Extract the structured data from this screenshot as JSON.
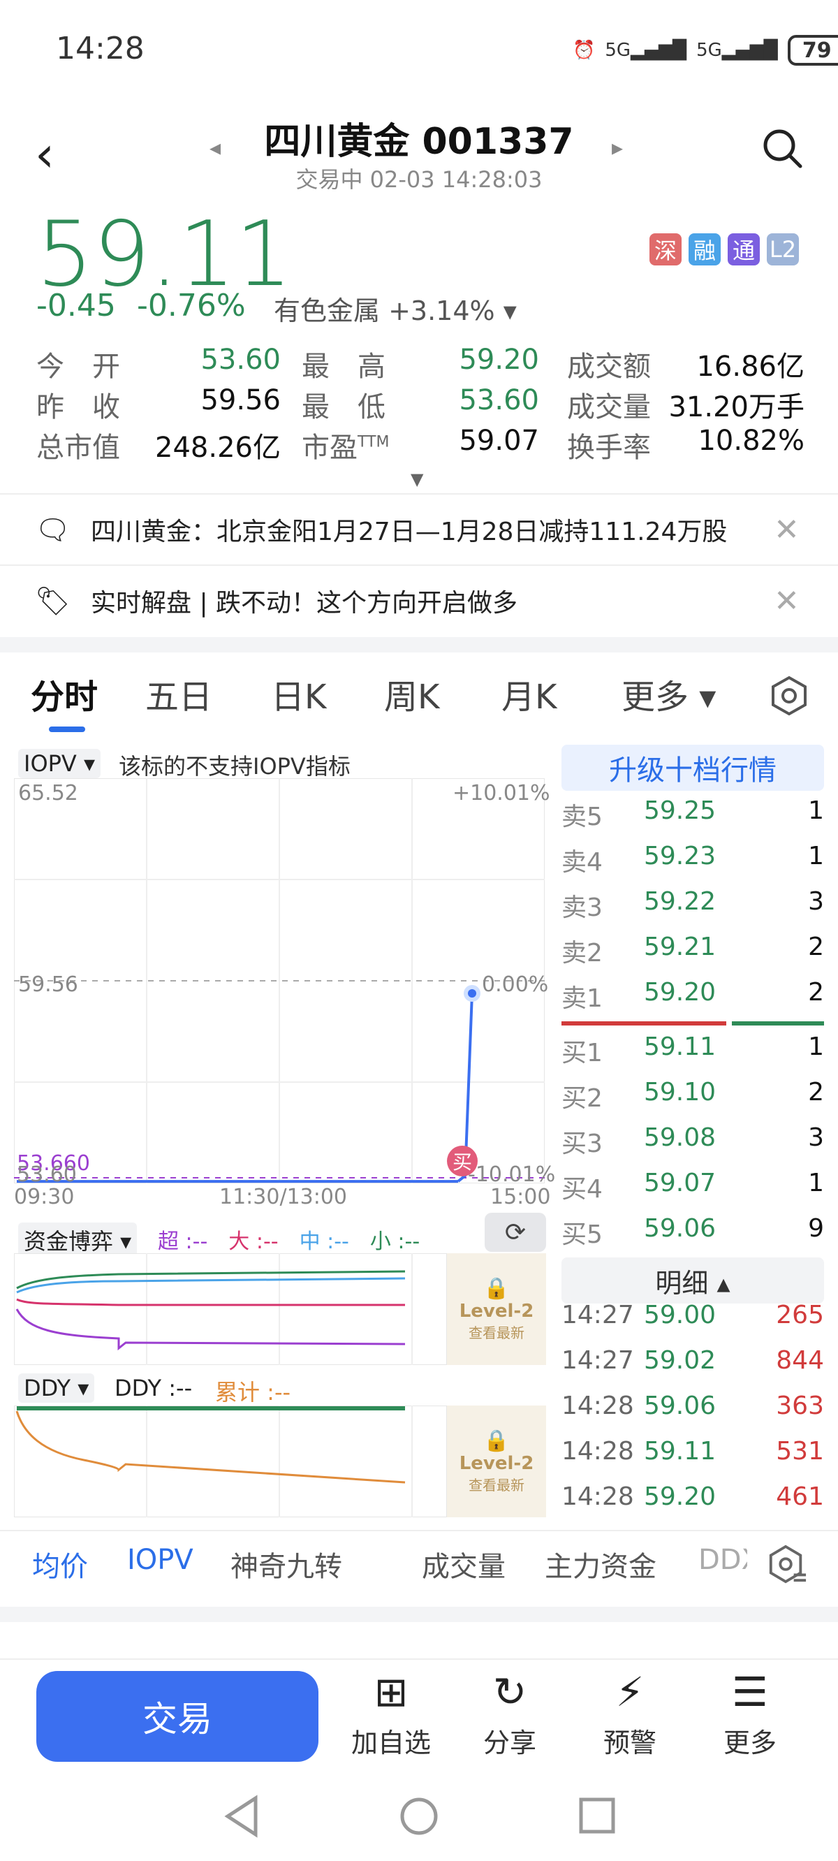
{
  "status": {
    "time": "14:28",
    "signal1": "5G",
    "signal2": "5G",
    "battery": "79"
  },
  "header": {
    "title": "四川黄金 001337",
    "subtitle": "交易中 02-03 14:28:03"
  },
  "quote": {
    "price": "59.11",
    "change": "-0.45",
    "change_pct": "-0.76%",
    "sector": "有色金属 +3.14% ▾",
    "badges": [
      {
        "label": "深",
        "color": "#e06b6b"
      },
      {
        "label": "融",
        "color": "#4aa3e8"
      },
      {
        "label": "通",
        "color": "#7b5fe0"
      },
      {
        "label": "L2",
        "color": "#9db4d8"
      }
    ],
    "stats": [
      [
        "今　开",
        "53.60",
        "最　高",
        "59.20",
        "成交额",
        "16.86亿"
      ],
      [
        "昨　收",
        "59.56",
        "最　低",
        "53.60",
        "成交量",
        "31.20万手"
      ],
      [
        "总市值",
        "248.26亿",
        "市盈TTM",
        "59.07",
        "换手率",
        "10.82%"
      ]
    ]
  },
  "news": [
    "四川黄金：北京金阳1月27日—1月28日减持111.24万股",
    "实时解盘 | 跌不动！这个方向开启做多"
  ],
  "tabs": [
    "分时",
    "五日",
    "日K",
    "周K",
    "月K",
    "更多 ▾"
  ],
  "chart": {
    "iopv_label": "IOPV ▾",
    "iopv_note": "该标的不支持IOPV指标",
    "y_high": "65.52",
    "y_high_pct": "+10.01%",
    "y_mid": "59.56",
    "y_mid_pct": "0.00%",
    "y_low": "53.660",
    "y_low2": "53.60",
    "y_low_pct": "-10.01%",
    "x_labels": [
      "09:30",
      "11:30/13:00",
      "15:00"
    ],
    "buy_mark": "买",
    "fund_label": "资金博弈 ▾",
    "fund_legend": [
      {
        "label": "超 :--",
        "color": "#9b3fd0"
      },
      {
        "label": "大 :--",
        "color": "#d6336c"
      },
      {
        "label": "中 :--",
        "color": "#4aa3e8"
      },
      {
        "label": "小 :--",
        "color": "#2e8b57"
      }
    ],
    "ddy_label": "DDY ▾",
    "ddy_value": "DDY :--",
    "ddy_cum": "累计 :--",
    "level2": "Level-2",
    "level2_sub": "查看最新"
  },
  "chart_data": {
    "type": "line",
    "title": "",
    "xlabel": "",
    "ylabel": "",
    "x": [
      "09:30",
      "14:28"
    ],
    "values": [
      53.66,
      59.11
    ],
    "ylim": [
      53.6,
      65.52
    ],
    "reference": 59.56
  },
  "orderbook": {
    "upgrade": "升级十档行情",
    "asks": [
      {
        "n": "卖5",
        "p": "59.25",
        "v": "1"
      },
      {
        "n": "卖4",
        "p": "59.23",
        "v": "1"
      },
      {
        "n": "卖3",
        "p": "59.22",
        "v": "3"
      },
      {
        "n": "卖2",
        "p": "59.21",
        "v": "2"
      },
      {
        "n": "卖1",
        "p": "59.20",
        "v": "2"
      }
    ],
    "bids": [
      {
        "n": "买1",
        "p": "59.11",
        "v": "1"
      },
      {
        "n": "买2",
        "p": "59.10",
        "v": "2"
      },
      {
        "n": "买3",
        "p": "59.08",
        "v": "3"
      },
      {
        "n": "买4",
        "p": "59.07",
        "v": "1"
      },
      {
        "n": "买5",
        "p": "59.06",
        "v": "9"
      }
    ],
    "detail_header": "明细 ▴",
    "details": [
      {
        "t": "14:27",
        "p": "59.00",
        "v": "265"
      },
      {
        "t": "14:27",
        "p": "59.02",
        "v": "844"
      },
      {
        "t": "14:28",
        "p": "59.06",
        "v": "363"
      },
      {
        "t": "14:28",
        "p": "59.11",
        "v": "531"
      },
      {
        "t": "14:28",
        "p": "59.20",
        "v": "461"
      }
    ]
  },
  "indicators": [
    "均价",
    "IOPV",
    "神奇九转",
    "成交量",
    "主力资金",
    "DDX"
  ],
  "actions": {
    "trade": "交易",
    "items": [
      {
        "icon": "⊞",
        "label": "加自选"
      },
      {
        "icon": "↻",
        "label": "分享"
      },
      {
        "icon": "⚡",
        "label": "预警"
      },
      {
        "icon": "☰",
        "label": "更多"
      }
    ]
  }
}
